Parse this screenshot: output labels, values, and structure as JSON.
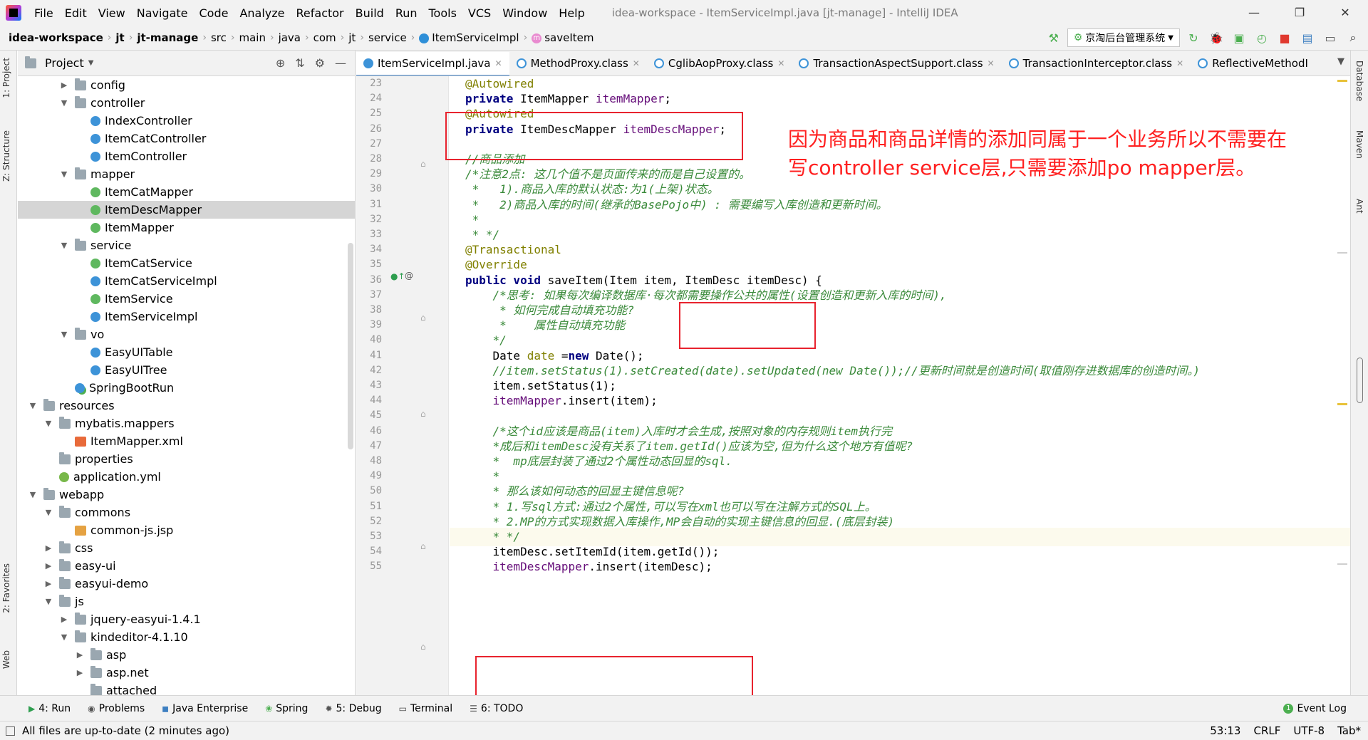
{
  "menubar": {
    "items": [
      "File",
      "Edit",
      "View",
      "Navigate",
      "Code",
      "Analyze",
      "Refactor",
      "Build",
      "Run",
      "Tools",
      "VCS",
      "Window",
      "Help"
    ],
    "window_title": "idea-workspace - ItemServiceImpl.java [jt-manage] - IntelliJ IDEA",
    "min": "—",
    "max": "❐",
    "close": "✕"
  },
  "navbar": {
    "crumbs": [
      "idea-workspace",
      "jt",
      "jt-manage",
      "src",
      "main",
      "java",
      "com",
      "jt",
      "service",
      "ItemServiceImpl",
      "saveItem"
    ],
    "run_config": "京淘后台管理系统"
  },
  "leftstrip": {
    "project": "1: Project",
    "structure": "Z: Structure",
    "favorites": "2: Favorites",
    "web": "Web"
  },
  "project": {
    "title": "Project",
    "tree": [
      {
        "label": "config",
        "icon": "folder",
        "depth": 3,
        "arrow": "▶"
      },
      {
        "label": "controller",
        "icon": "folder",
        "depth": 3,
        "arrow": "▼"
      },
      {
        "label": "IndexController",
        "icon": "class",
        "depth": 4,
        "arrow": ""
      },
      {
        "label": "ItemCatController",
        "icon": "class",
        "depth": 4,
        "arrow": ""
      },
      {
        "label": "ItemController",
        "icon": "class",
        "depth": 4,
        "arrow": ""
      },
      {
        "label": "mapper",
        "icon": "folder",
        "depth": 3,
        "arrow": "▼"
      },
      {
        "label": "ItemCatMapper",
        "icon": "iface",
        "depth": 4,
        "arrow": ""
      },
      {
        "label": "ItemDescMapper",
        "icon": "iface",
        "depth": 4,
        "arrow": "",
        "selected": true
      },
      {
        "label": "ItemMapper",
        "icon": "iface",
        "depth": 4,
        "arrow": ""
      },
      {
        "label": "service",
        "icon": "folder",
        "depth": 3,
        "arrow": "▼"
      },
      {
        "label": "ItemCatService",
        "icon": "iface",
        "depth": 4,
        "arrow": ""
      },
      {
        "label": "ItemCatServiceImpl",
        "icon": "class",
        "depth": 4,
        "arrow": ""
      },
      {
        "label": "ItemService",
        "icon": "iface",
        "depth": 4,
        "arrow": ""
      },
      {
        "label": "ItemServiceImpl",
        "icon": "class",
        "depth": 4,
        "arrow": ""
      },
      {
        "label": "vo",
        "icon": "folder",
        "depth": 3,
        "arrow": "▼"
      },
      {
        "label": "EasyUITable",
        "icon": "class",
        "depth": 4,
        "arrow": ""
      },
      {
        "label": "EasyUITree",
        "icon": "class",
        "depth": 4,
        "arrow": ""
      },
      {
        "label": "SpringBootRun",
        "icon": "app",
        "depth": 3,
        "arrow": ""
      },
      {
        "label": "resources",
        "icon": "folder",
        "depth": 1,
        "arrow": "▼"
      },
      {
        "label": "mybatis.mappers",
        "icon": "folder",
        "depth": 2,
        "arrow": "▼"
      },
      {
        "label": "ItemMapper.xml",
        "icon": "xml",
        "depth": 3,
        "arrow": ""
      },
      {
        "label": "properties",
        "icon": "folder",
        "depth": 2,
        "arrow": ""
      },
      {
        "label": "application.yml",
        "icon": "yml",
        "depth": 2,
        "arrow": ""
      },
      {
        "label": "webapp",
        "icon": "folder",
        "depth": 1,
        "arrow": "▼"
      },
      {
        "label": "commons",
        "icon": "folder",
        "depth": 2,
        "arrow": "▼"
      },
      {
        "label": "common-js.jsp",
        "icon": "jsp",
        "depth": 3,
        "arrow": ""
      },
      {
        "label": "css",
        "icon": "folder",
        "depth": 2,
        "arrow": "▶"
      },
      {
        "label": "easy-ui",
        "icon": "folder",
        "depth": 2,
        "arrow": "▶"
      },
      {
        "label": "easyui-demo",
        "icon": "folder",
        "depth": 2,
        "arrow": "▶"
      },
      {
        "label": "js",
        "icon": "folder",
        "depth": 2,
        "arrow": "▼"
      },
      {
        "label": "jquery-easyui-1.4.1",
        "icon": "folder",
        "depth": 3,
        "arrow": "▶"
      },
      {
        "label": "kindeditor-4.1.10",
        "icon": "folder",
        "depth": 3,
        "arrow": "▼"
      },
      {
        "label": "asp",
        "icon": "folder",
        "depth": 4,
        "arrow": "▶"
      },
      {
        "label": "asp.net",
        "icon": "folder",
        "depth": 4,
        "arrow": "▶"
      },
      {
        "label": "attached",
        "icon": "folder",
        "depth": 4,
        "arrow": ""
      }
    ]
  },
  "tabs": [
    "ItemServiceImpl.java",
    "MethodProxy.class",
    "CglibAopProxy.class",
    "TransactionAspectSupport.class",
    "TransactionInterceptor.class",
    "ReflectiveMethodI"
  ],
  "editor": {
    "line_numbers": [
      "23",
      "24",
      "25",
      "26",
      "27",
      "28",
      "29",
      "30",
      "31",
      "32",
      "33",
      "34",
      "35",
      "36",
      "37",
      "38",
      "39",
      "40",
      "41",
      "42",
      "43",
      "44",
      "45",
      "46",
      "47",
      "48",
      "49",
      "50",
      "51",
      "52",
      "53",
      "54",
      "55"
    ],
    "lines": [
      [
        {
          "c": "ann",
          "t": "@Autowired"
        }
      ],
      [
        {
          "c": "kw",
          "t": "private "
        },
        {
          "c": "ty",
          "t": "ItemMapper "
        },
        {
          "c": "fld",
          "t": "itemMapper"
        },
        {
          "c": "ty",
          "t": ";"
        }
      ],
      [
        {
          "c": "ann",
          "t": "@Autowired"
        }
      ],
      [
        {
          "c": "kw",
          "t": "private "
        },
        {
          "c": "ty",
          "t": "ItemDescMapper "
        },
        {
          "c": "fld",
          "t": "itemDescMapper"
        },
        {
          "c": "ty",
          "t": ";"
        }
      ],
      [],
      [
        {
          "c": "cmt",
          "t": "//商品添加"
        }
      ],
      [
        {
          "c": "cmt",
          "t": "/*注意2点: 这几个值不是页面传来的而是自己设置的。"
        }
      ],
      [
        {
          "c": "cmt",
          "t": " *   1).商品入库的默认状态:为1(上架)状态。"
        }
      ],
      [
        {
          "c": "cmt",
          "t": " *   2)商品入库的时间(继承的BasePojo中) : 需要编写入库创造和更新时间。"
        }
      ],
      [
        {
          "c": "cmt",
          "t": " *"
        }
      ],
      [
        {
          "c": "cmt",
          "t": " * */"
        }
      ],
      [
        {
          "c": "ann",
          "t": "@Transactional"
        }
      ],
      [
        {
          "c": "ann",
          "t": "@Override"
        }
      ],
      [
        {
          "c": "kw",
          "t": "public void "
        },
        {
          "c": "ty",
          "t": "saveItem(Item item, ItemDesc itemDesc) {"
        }
      ],
      [
        {
          "c": "cmt",
          "t": "    /*思考: 如果每次编译数据库·每次都需要操作公共的属性(设置创造和更新入库的时间),"
        }
      ],
      [
        {
          "c": "cmt",
          "t": "     * 如何完成自动填充功能?"
        }
      ],
      [
        {
          "c": "cmt",
          "t": "     *    属性自动填充功能"
        }
      ],
      [
        {
          "c": "cmt",
          "t": "    */"
        }
      ],
      [
        {
          "c": "ty",
          "t": "    Date "
        },
        {
          "c": "ann",
          "t": "date "
        },
        {
          "c": "ty",
          "t": "="
        },
        {
          "c": "kw",
          "t": "new "
        },
        {
          "c": "ty",
          "t": "Date();"
        }
      ],
      [
        {
          "c": "cmt",
          "t": "    //item.setStatus(1).setCreated(date).setUpdated(new Date());//更新时间就是创造时间(取值刚存进数据库的创造时间。)"
        }
      ],
      [
        {
          "c": "ty",
          "t": "    item.setStatus(1);"
        }
      ],
      [
        {
          "c": "fld",
          "t": "    itemMapper"
        },
        {
          "c": "ty",
          "t": ".insert(item);"
        }
      ],
      [],
      [
        {
          "c": "cmt",
          "t": "    /*这个id应该是商品(item)入库时才会生成,按照对象的内存规则item执行完"
        }
      ],
      [
        {
          "c": "cmt",
          "t": "    *成后和itemDesc没有关系了item.getId()应该为空,但为什么这个地方有值呢?"
        }
      ],
      [
        {
          "c": "cmt",
          "t": "    *  mp底层封装了通过2个属性动态回显的sql."
        }
      ],
      [
        {
          "c": "cmt",
          "t": "    *"
        }
      ],
      [
        {
          "c": "cmt",
          "t": "    * 那么该如何动态的回显主键信息呢?"
        }
      ],
      [
        {
          "c": "cmt",
          "t": "    * 1.写sql方式:通过2个属性,可以写在xml也可以写在注解方式的SQL上。"
        }
      ],
      [
        {
          "c": "cmt",
          "t": "    * 2.MP的方式实现数据入库操作,MP会自动的实现主键信息的回显.(底层封装)"
        }
      ],
      [
        {
          "c": "cmt",
          "t": "    * */"
        }
      ],
      [
        {
          "c": "ty",
          "t": "    itemDesc.setItemId(item.getId());"
        }
      ],
      [
        {
          "c": "fld",
          "t": "    itemDescMapper"
        },
        {
          "c": "ty",
          "t": ".insert(itemDesc);"
        }
      ]
    ],
    "callout": "因为商品和商品详情的添加同属于一个业务所以不需要在写controller service层,只需要添加po mapper层。"
  },
  "rightstrip": {
    "database": "Database",
    "maven": "Maven",
    "ant": "Ant"
  },
  "bottombar": {
    "items": [
      "4: Run",
      "Problems",
      "Java Enterprise",
      "Spring",
      "5: Debug",
      "Terminal",
      "6: TODO"
    ],
    "event_log": "Event Log"
  },
  "statusbar": {
    "message": "All files are up-to-date (2 minutes ago)",
    "position": "53:13",
    "line_sep": "CRLF",
    "encoding": "UTF-8",
    "indent": "Tab*"
  }
}
